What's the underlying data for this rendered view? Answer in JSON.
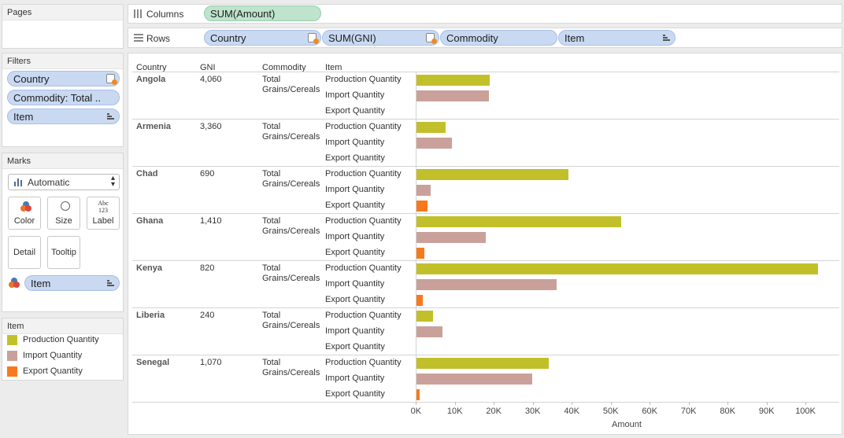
{
  "pages": {
    "title": "Pages"
  },
  "filters": {
    "title": "Filters",
    "items": [
      "Country",
      "Commodity: Total ..",
      "Item"
    ]
  },
  "marks": {
    "title": "Marks",
    "type": "Automatic",
    "buttons": {
      "color": "Color",
      "size": "Size",
      "label": "Label",
      "label_icon": "Abc\n123",
      "detail": "Detail",
      "tooltip": "Tooltip"
    },
    "color_field": "Item"
  },
  "legend": {
    "title": "Item",
    "items": [
      {
        "label": "Production Quantity",
        "color": "#c2c02a"
      },
      {
        "label": "Import Quantity",
        "color": "#c9a19a"
      },
      {
        "label": "Export Quantity",
        "color": "#f7791d"
      }
    ]
  },
  "shelves": {
    "columns_label": "Columns",
    "columns": [
      "SUM(Amount)"
    ],
    "rows_label": "Rows",
    "rows": [
      "Country",
      "SUM(GNI)",
      "Commodity",
      "Item"
    ]
  },
  "table": {
    "headers": {
      "country": "Country",
      "gni": "GNI",
      "commodity": "Commodity",
      "item": "Item"
    },
    "item_labels": [
      "Production Quantity",
      "Import Quantity",
      "Export Quantity"
    ]
  },
  "chart_data": {
    "type": "bar",
    "orientation": "horizontal",
    "xlabel": "Amount",
    "xlim": [
      0,
      105000
    ],
    "ticks": [
      {
        "value": 0,
        "label": "0K"
      },
      {
        "value": 10000,
        "label": "10K"
      },
      {
        "value": 20000,
        "label": "20K"
      },
      {
        "value": 30000,
        "label": "30K"
      },
      {
        "value": 40000,
        "label": "40K"
      },
      {
        "value": 50000,
        "label": "50K"
      },
      {
        "value": 60000,
        "label": "60K"
      },
      {
        "value": 70000,
        "label": "70K"
      },
      {
        "value": 80000,
        "label": "80K"
      },
      {
        "value": 90000,
        "label": "90K"
      },
      {
        "value": 100000,
        "label": "100K"
      }
    ],
    "series_colors": [
      "#c2c02a",
      "#c9a19a",
      "#f7791d"
    ],
    "rows": [
      {
        "country": "Angola",
        "gni": "4,060",
        "commodity": "Total Grains/Cereals",
        "values": [
          18800,
          18500,
          0
        ]
      },
      {
        "country": "Armenia",
        "gni": "3,360",
        "commodity": "Total Grains/Cereals",
        "values": [
          7500,
          9000,
          0
        ]
      },
      {
        "country": "Chad",
        "gni": "690",
        "commodity": "Total Grains/Cereals",
        "values": [
          39000,
          3700,
          2800
        ]
      },
      {
        "country": "Ghana",
        "gni": "1,410",
        "commodity": "Total Grains/Cereals",
        "values": [
          52500,
          17700,
          2000
        ]
      },
      {
        "country": "Kenya",
        "gni": "820",
        "commodity": "Total Grains/Cereals",
        "values": [
          103000,
          35900,
          1700
        ]
      },
      {
        "country": "Liberia",
        "gni": "240",
        "commodity": "Total Grains/Cereals",
        "values": [
          4300,
          6600,
          0
        ]
      },
      {
        "country": "Senegal",
        "gni": "1,070",
        "commodity": "Total Grains/Cereals",
        "values": [
          34000,
          29600,
          800
        ]
      }
    ]
  }
}
